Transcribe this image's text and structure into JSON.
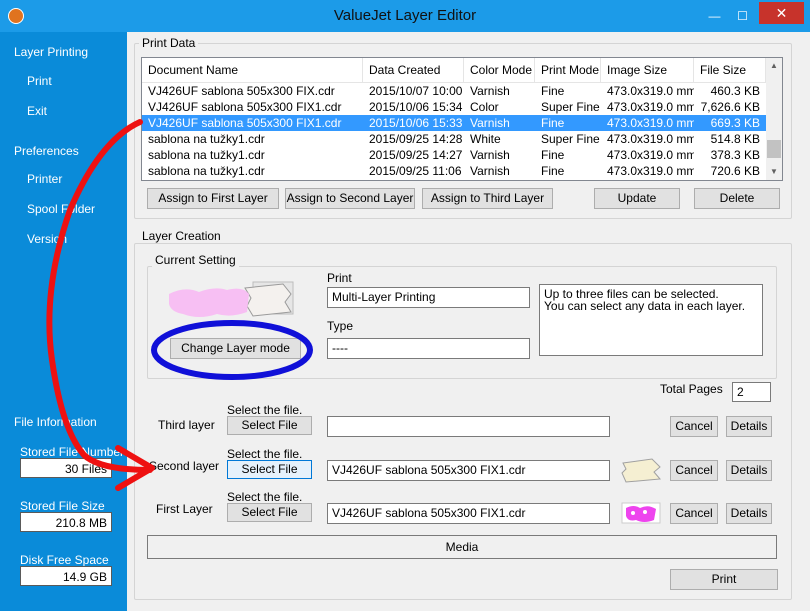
{
  "window": {
    "title": "ValueJet Layer Editor",
    "minimize": "—",
    "maximize": "☐",
    "close": "✕"
  },
  "sidebar": {
    "layer_printing": "Layer Printing",
    "print": "Print",
    "exit": "Exit",
    "preferences": "Preferences",
    "printer": "Printer",
    "spool_folder": "Spool Folder",
    "version": "Version",
    "file_information": "File Information",
    "stored_file_number_label": "Stored File Number",
    "stored_file_number": "30 Files",
    "stored_file_size_label": "Stored File Size",
    "stored_file_size": "210.8 MB",
    "disk_free_space_label": "Disk Free Space",
    "disk_free_space": "14.9 GB"
  },
  "print_data": {
    "title": "Print Data",
    "columns": [
      "Document Name",
      "Data Created",
      "Color Mode",
      "Print Mode",
      "Image Size",
      "File Size"
    ],
    "rows": [
      [
        "VJ426UF sablona 505x300 FIX.cdr",
        "2015/10/07 10:00",
        "Varnish",
        "Fine",
        "473.0x319.0 mm",
        "460.3 KB"
      ],
      [
        "VJ426UF sablona 505x300 FIX1.cdr",
        "2015/10/06 15:34",
        "Color",
        "Super Fine",
        "473.0x319.0 mm",
        "7,626.6 KB"
      ],
      [
        "VJ426UF sablona 505x300 FIX1.cdr",
        "2015/10/06 15:33",
        "Varnish",
        "Fine",
        "473.0x319.0 mm",
        "669.3 KB"
      ],
      [
        "sablona na tužky1.cdr",
        "2015/09/25 14:28",
        "White",
        "Super Fine",
        "473.0x319.0 mm",
        "514.8 KB"
      ],
      [
        "sablona na tužky1.cdr",
        "2015/09/25 14:27",
        "Varnish",
        "Fine",
        "473.0x319.0 mm",
        "378.3 KB"
      ],
      [
        "sablona na tužky1.cdr",
        "2015/09/25 11:06",
        "Varnish",
        "Fine",
        "473.0x319.0 mm",
        "720.6 KB"
      ]
    ],
    "selected_row": 2,
    "assign_first": "Assign to First Layer",
    "assign_second": "Assign to Second Layer",
    "assign_third": "Assign to Third Layer",
    "update": "Update",
    "delete": "Delete"
  },
  "layer_creation": {
    "title": "Layer Creation",
    "current_setting": "Current Setting",
    "change_layer_mode": "Change Layer mode",
    "print_label": "Print",
    "print_value": "Multi-Layer Printing",
    "type_label": "Type",
    "type_value": "----",
    "info_text": "Up to three files can be selected.\nYou can select any data in each layer.",
    "total_pages_label": "Total Pages",
    "total_pages": "2",
    "select_the_file": "Select the file.",
    "select_file": "Select File",
    "cancel": "Cancel",
    "details": "Details",
    "third_layer": "Third layer",
    "third_file": "",
    "second_layer": "Second layer",
    "second_file": "VJ426UF sablona 505x300 FIX1.cdr",
    "first_layer": "First Layer",
    "first_file": "VJ426UF sablona 505x300 FIX1.cdr",
    "media": "Media",
    "print_button": "Print"
  },
  "colors": {
    "accent": "#0a8bd9",
    "selection": "#3399ff",
    "close": "#c7332b",
    "annotation_red": "#ee1111",
    "annotation_blue": "#1010d8"
  }
}
